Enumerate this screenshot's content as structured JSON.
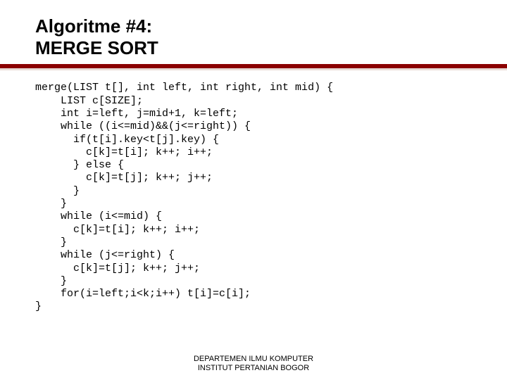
{
  "title_line1": "Algoritme #4:",
  "title_line2": "MERGE SORT",
  "code_lines": [
    "merge(LIST t[], int left, int right, int mid) {",
    "    LIST c[SIZE];",
    "    int i=left, j=mid+1, k=left;",
    "    while ((i<=mid)&&(j<=right)) {",
    "      if(t[i].key<t[j].key) {",
    "        c[k]=t[i]; k++; i++;",
    "      } else {",
    "        c[k]=t[j]; k++; j++;",
    "      }",
    "    }",
    "    while (i<=mid) {",
    "      c[k]=t[i]; k++; i++;",
    "    }",
    "    while (j<=right) {",
    "      c[k]=t[j]; k++; j++;",
    "    }",
    "    for(i=left;i<k;i++) t[i]=c[i];",
    "}"
  ],
  "footer_line1": "DEPARTEMEN ILMU KOMPUTER",
  "footer_line2": "INSTITUT PERTANIAN BOGOR"
}
